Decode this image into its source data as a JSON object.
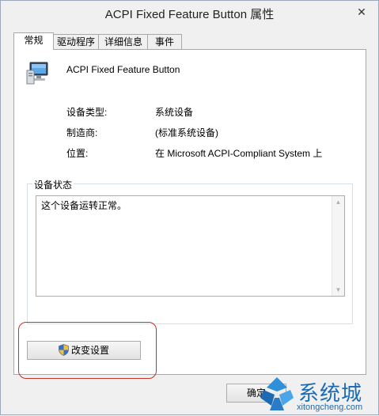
{
  "window": {
    "title": "ACPI Fixed Feature Button 属性",
    "close_glyph": "✕"
  },
  "tabs": [
    {
      "label": "常规"
    },
    {
      "label": "驱动程序"
    },
    {
      "label": "详细信息"
    },
    {
      "label": "事件"
    }
  ],
  "general": {
    "device_name": "ACPI Fixed Feature Button",
    "icon": "monitor-icon",
    "properties": [
      {
        "label": "设备类型:",
        "value": "系统设备"
      },
      {
        "label": "制造商:",
        "value": "(标准系统设备)"
      },
      {
        "label": "位置:",
        "value": "在 Microsoft ACPI-Compliant System 上"
      }
    ],
    "status_group_label": "设备状态",
    "status_text": "这个设备运转正常。",
    "change_settings_label": "改变设置"
  },
  "footer": {
    "ok_label": "确定"
  },
  "watermark": {
    "brand": "系统城",
    "url": "xitongcheng.com"
  },
  "colors": {
    "highlight": "#c0342a",
    "watermark": "#1b6ab3"
  }
}
